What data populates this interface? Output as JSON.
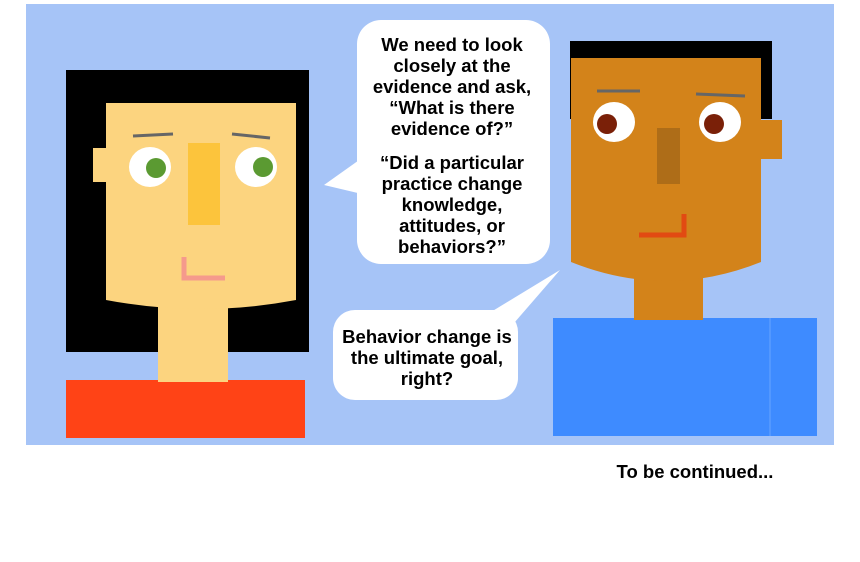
{
  "comic": {
    "speech_bubble_1": {
      "paragraph_1": "We need to look closely at the evidence and ask, “What is there evidence of?”",
      "paragraph_2": "“Did a particular practice change knowledge, attitudes, or behaviors?”"
    },
    "speech_bubble_2": {
      "text": "Behavior change is the ultimate goal, right?"
    },
    "caption": "To be continued..."
  },
  "colors": {
    "background_panel": "#a6c4f7",
    "woman_skin": "#fcd47f",
    "woman_hair": "#000000",
    "woman_nose": "#fcc43c",
    "woman_eyes": "#5b9a32",
    "woman_mouth": "#f59a8c",
    "woman_shirt": "#ff4316",
    "man_skin": "#d3831a",
    "man_hair": "#000000",
    "man_nose": "#ae6d18",
    "man_eyes": "#7a2008",
    "man_mouth": "#e24a12",
    "man_shirt": "#3e8bff",
    "bubble_fill": "#ffffff"
  }
}
